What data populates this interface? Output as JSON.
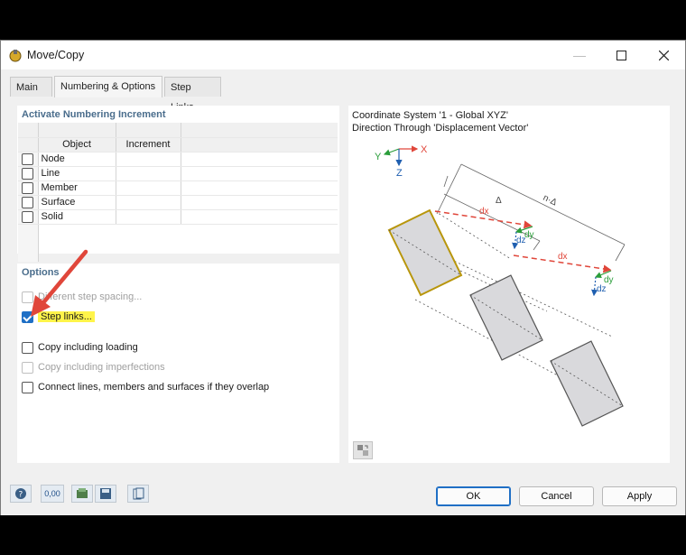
{
  "window": {
    "title": "Move/Copy"
  },
  "tabs": [
    {
      "label": "Main"
    },
    {
      "label": "Numbering & Options"
    },
    {
      "label": "Step Links"
    }
  ],
  "numbering": {
    "title": "Activate Numbering Increment",
    "col_object": "Object",
    "col_increment": "Increment",
    "rows": [
      {
        "label": "Node",
        "checked": false
      },
      {
        "label": "Line",
        "checked": false
      },
      {
        "label": "Member",
        "checked": false
      },
      {
        "label": "Surface",
        "checked": false
      },
      {
        "label": "Solid",
        "checked": false
      }
    ]
  },
  "options": {
    "title": "Options",
    "items": [
      {
        "label": "Different step spacing...",
        "checked": false,
        "disabled": true
      },
      {
        "label": "Step links...",
        "checked": true,
        "disabled": false,
        "highlight": "#fff44a"
      },
      {
        "label": "Copy including loading",
        "checked": false,
        "disabled": false
      },
      {
        "label": "Copy including imperfections",
        "checked": false,
        "disabled": true
      },
      {
        "label": "Connect lines, members and surfaces if they overlap",
        "checked": false,
        "disabled": false
      }
    ]
  },
  "preview": {
    "line1": "Coordinate System '1 - Global XYZ'",
    "line2": "Direction Through 'Displacement Vector'",
    "axis_x": "X",
    "axis_y": "Y",
    "axis_z": "Z",
    "label_delta": "Δ",
    "label_ndelta": "n·Δ",
    "label_dx": "dx",
    "label_dy": "dy",
    "label_dz": "dz"
  },
  "footer": {
    "ok": "OK",
    "cancel": "Cancel",
    "apply": "Apply",
    "tool_value": "0,00"
  },
  "colors": {
    "accent": "#1f6fc5",
    "section_title": "#4a6d8c",
    "highlight": "#fff44a",
    "arrow": "#e0463a",
    "outline_original": "#b8960c"
  }
}
